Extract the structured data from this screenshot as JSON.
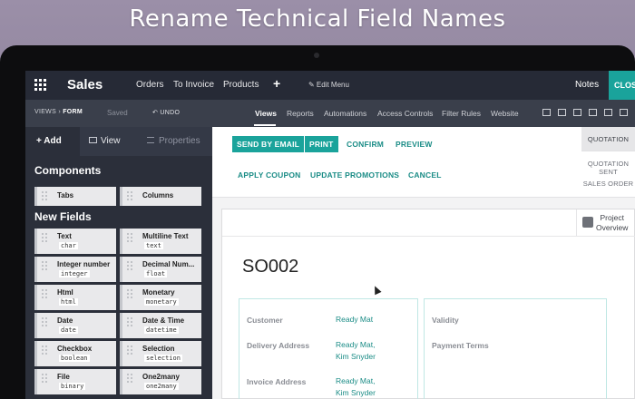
{
  "headline": "Rename Technical Field Names",
  "topnav": {
    "app_title": "Sales",
    "items": [
      "Orders",
      "To Invoice",
      "Products"
    ],
    "add_symbol": "+",
    "edit_menu": "✎ Edit Menu",
    "notes": "Notes",
    "close": "CLOSE"
  },
  "subnav": {
    "breadcrumb_views": "VIEWS",
    "breadcrumb_sep": "›",
    "breadcrumb_form": "FORM",
    "saved": "Saved",
    "undo": "↶ UNDO",
    "tabs": [
      "Views",
      "Reports",
      "Automations",
      "Access Controls",
      "Filter Rules",
      "Website"
    ],
    "active_tab": "Views"
  },
  "sidebar": {
    "tabs": {
      "add": "+ Add",
      "view": "View",
      "properties": "Properties"
    },
    "components_heading": "Components",
    "components": [
      {
        "label": "Tabs"
      },
      {
        "label": "Columns"
      }
    ],
    "new_fields_heading": "New Fields",
    "fields": [
      {
        "label": "Text",
        "type": "char"
      },
      {
        "label": "Multiline Text",
        "type": "text"
      },
      {
        "label": "Integer number",
        "type": "integer"
      },
      {
        "label": "Decimal Num...",
        "type": "float"
      },
      {
        "label": "Html",
        "type": "html"
      },
      {
        "label": "Monetary",
        "type": "monetary"
      },
      {
        "label": "Date",
        "type": "date"
      },
      {
        "label": "Date & Time",
        "type": "datetime"
      },
      {
        "label": "Checkbox",
        "type": "boolean"
      },
      {
        "label": "Selection",
        "type": "selection"
      },
      {
        "label": "File",
        "type": "binary"
      },
      {
        "label": "One2many",
        "type": "one2many"
      }
    ]
  },
  "actions": {
    "send_by_email": "SEND BY EMAIL",
    "print": "PRINT",
    "confirm": "CONFIRM",
    "preview": "PREVIEW",
    "apply_coupon": "APPLY COUPON",
    "update_promotions": "UPDATE PROMOTIONS",
    "cancel": "CANCEL"
  },
  "status": {
    "quotation": "QUOTATION",
    "quotation_sent": "QUOTATION SENT",
    "sales_order": "SALES ORDER"
  },
  "sheet": {
    "project_button": [
      "Project",
      "Overview"
    ],
    "order_number": "SO002",
    "left_fields": [
      {
        "label": "Customer",
        "value": [
          "Ready Mat"
        ]
      },
      {
        "label": "Delivery Address",
        "value": [
          "Ready Mat,",
          "Kim Snyder"
        ]
      },
      {
        "label": "Invoice Address",
        "value": [
          "Ready Mat,",
          "Kim Snyder"
        ]
      }
    ],
    "right_fields": [
      {
        "label": "Validity"
      },
      {
        "label": "Payment Terms"
      }
    ]
  },
  "colors": {
    "accent": "#1aa39b",
    "nav_bg": "#262a36",
    "sidebar_bg": "#2b2f3a"
  }
}
